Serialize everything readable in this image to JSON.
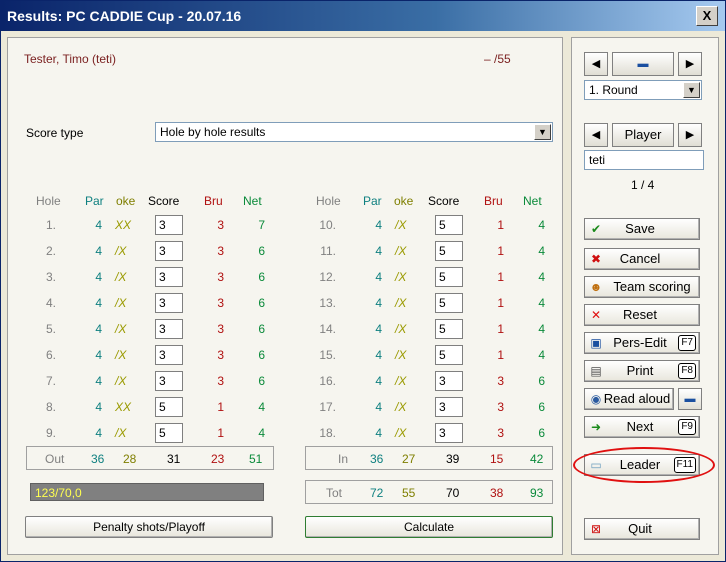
{
  "window": {
    "title": "Results: PC CADDIE Cup - 20.07.16",
    "close_label": "X"
  },
  "player": {
    "name": "Tester, Timo (teti)",
    "total": "– /55"
  },
  "score_type": {
    "label": "Score type",
    "value": "Hole by hole results"
  },
  "headers": {
    "hole": "Hole",
    "par": "Par",
    "stroke": "oke",
    "score": "Score",
    "bru": "Bru",
    "net": "Net"
  },
  "front": [
    {
      "hole": "1.",
      "par": "4",
      "stroke": "XX",
      "score": "3",
      "bru": "3",
      "net": "7"
    },
    {
      "hole": "2.",
      "par": "4",
      "stroke": "/X",
      "score": "3",
      "bru": "3",
      "net": "6"
    },
    {
      "hole": "3.",
      "par": "4",
      "stroke": "/X",
      "score": "3",
      "bru": "3",
      "net": "6"
    },
    {
      "hole": "4.",
      "par": "4",
      "stroke": "/X",
      "score": "3",
      "bru": "3",
      "net": "6"
    },
    {
      "hole": "5.",
      "par": "4",
      "stroke": "/X",
      "score": "3",
      "bru": "3",
      "net": "6"
    },
    {
      "hole": "6.",
      "par": "4",
      "stroke": "/X",
      "score": "3",
      "bru": "3",
      "net": "6"
    },
    {
      "hole": "7.",
      "par": "4",
      "stroke": "/X",
      "score": "3",
      "bru": "3",
      "net": "6"
    },
    {
      "hole": "8.",
      "par": "4",
      "stroke": "XX",
      "score": "5",
      "bru": "1",
      "net": "4"
    },
    {
      "hole": "9.",
      "par": "4",
      "stroke": "/X",
      "score": "5",
      "bru": "1",
      "net": "4"
    }
  ],
  "back": [
    {
      "hole": "10.",
      "par": "4",
      "stroke": "/X",
      "score": "5",
      "bru": "1",
      "net": "4"
    },
    {
      "hole": "11.",
      "par": "4",
      "stroke": "/X",
      "score": "5",
      "bru": "1",
      "net": "4"
    },
    {
      "hole": "12.",
      "par": "4",
      "stroke": "/X",
      "score": "5",
      "bru": "1",
      "net": "4"
    },
    {
      "hole": "13.",
      "par": "4",
      "stroke": "/X",
      "score": "5",
      "bru": "1",
      "net": "4"
    },
    {
      "hole": "14.",
      "par": "4",
      "stroke": "/X",
      "score": "5",
      "bru": "1",
      "net": "4"
    },
    {
      "hole": "15.",
      "par": "4",
      "stroke": "/X",
      "score": "5",
      "bru": "1",
      "net": "4"
    },
    {
      "hole": "16.",
      "par": "4",
      "stroke": "/X",
      "score": "3",
      "bru": "3",
      "net": "6"
    },
    {
      "hole": "17.",
      "par": "4",
      "stroke": "/X",
      "score": "3",
      "bru": "3",
      "net": "6"
    },
    {
      "hole": "18.",
      "par": "4",
      "stroke": "/X",
      "score": "3",
      "bru": "3",
      "net": "6"
    }
  ],
  "out_sum": {
    "label": "Out",
    "par": "36",
    "stroke": "28",
    "score": "31",
    "bru": "23",
    "net": "51"
  },
  "in_sum": {
    "label": "In",
    "par": "36",
    "stroke": "27",
    "score": "39",
    "bru": "15",
    "net": "42"
  },
  "tot_sum": {
    "label": "Tot",
    "par": "72",
    "stroke": "55",
    "score": "70",
    "bru": "38",
    "net": "93"
  },
  "progress": {
    "text": "123/70,0"
  },
  "buttons": {
    "penalty": "Penalty shots/Playoff",
    "calculate": "Calculate"
  },
  "side": {
    "round_value": "1. Round",
    "player_label": "Player",
    "player_input": "teti",
    "player_count": "1 / 4",
    "save": "Save",
    "cancel": "Cancel",
    "team_scoring": "Team scoring",
    "reset": "Reset",
    "pers_edit": "Pers-Edit",
    "pers_edit_key": "F7",
    "print": "Print",
    "print_key": "F8",
    "read_aloud": "Read aloud",
    "next": "Next",
    "next_key": "F9",
    "leader": "Leader",
    "leader_key": "F11",
    "quit": "Quit"
  },
  "colors": {
    "accent_red": "#e01010",
    "title_blue": "#0a246a"
  }
}
